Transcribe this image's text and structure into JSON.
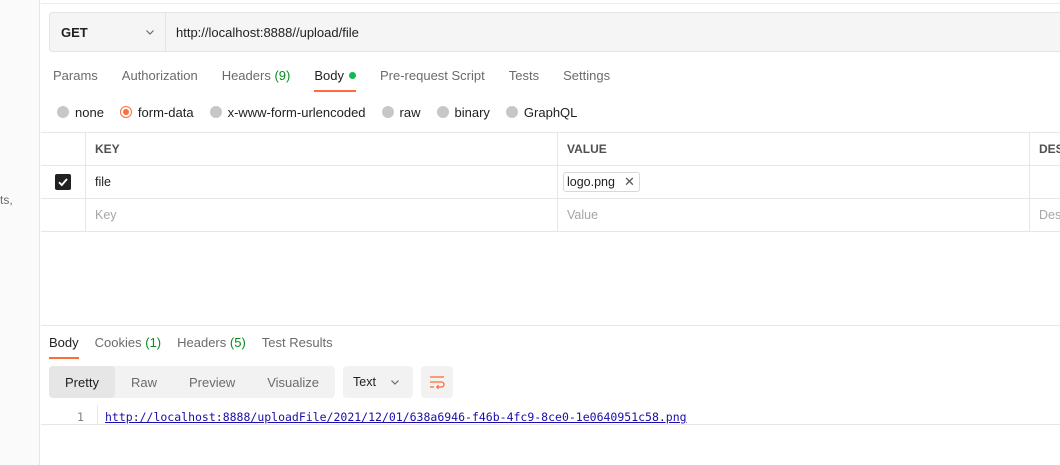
{
  "left_gutter": {
    "fragment": "ts,"
  },
  "request": {
    "method": "GET",
    "url": "http://localhost:8888//upload/file"
  },
  "request_tabs": [
    {
      "label": "Params"
    },
    {
      "label": "Authorization"
    },
    {
      "label": "Headers",
      "count": "(9)"
    },
    {
      "label": "Body",
      "active": true,
      "indicator": "green-dot"
    },
    {
      "label": "Pre-request Script"
    },
    {
      "label": "Tests"
    },
    {
      "label": "Settings"
    }
  ],
  "body_types": [
    {
      "label": "none",
      "selected": false
    },
    {
      "label": "form-data",
      "selected": true
    },
    {
      "label": "x-www-form-urlencoded",
      "selected": false
    },
    {
      "label": "raw",
      "selected": false
    },
    {
      "label": "binary",
      "selected": false
    },
    {
      "label": "GraphQL",
      "selected": false
    }
  ],
  "form_table": {
    "headers": {
      "key": "KEY",
      "value": "VALUE",
      "description": "DES"
    },
    "rows": [
      {
        "checked": true,
        "key": "file",
        "value_file": "logo.png"
      }
    ],
    "placeholder": {
      "key": "Key",
      "value": "Value",
      "description": "Des"
    }
  },
  "response_tabs": [
    {
      "label": "Body",
      "active": true
    },
    {
      "label": "Cookies",
      "count": "(1)"
    },
    {
      "label": "Headers",
      "count": "(5)"
    },
    {
      "label": "Test Results"
    }
  ],
  "response_views": [
    "Pretty",
    "Raw",
    "Preview",
    "Visualize"
  ],
  "response_format": "Text",
  "response_body": {
    "line_number": "1",
    "content": "http://localhost:8888/uploadFile/2021/12/01/638a6946-f46b-4fc9-8ce0-1e0640951c58.png"
  },
  "colors": {
    "accent": "#ff6c37",
    "count_green": "#0a8a1f",
    "dot_green": "#0cbb52",
    "link": "#1a0dab"
  }
}
